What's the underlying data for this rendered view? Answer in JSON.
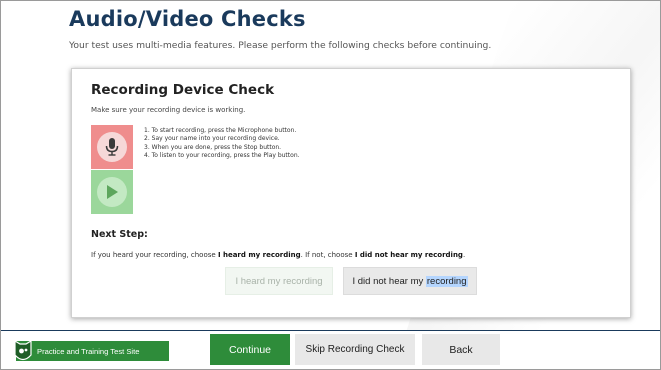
{
  "page": {
    "title": "Audio/Video Checks",
    "subtitle": "Your test uses multi-media features. Please perform the following checks before continuing."
  },
  "recording_check": {
    "title": "Recording Device Check",
    "subtitle": "Make sure your recording device is working.",
    "steps": [
      "1. To start recording, press the Microphone button.",
      "2. Say your name into your recording device.",
      "3. When you are done, press the Stop button.",
      "4. To listen to your recording, press the Play button."
    ],
    "microphone_icon": "microphone-icon",
    "play_icon": "play-icon",
    "colors": {
      "mic_bg": "#ef8d8d",
      "play_bg": "#9bd79b"
    }
  },
  "next_step": {
    "heading": "Next Step:",
    "text_1": "If you heard your recording, choose ",
    "bold_1": "I heard my recording",
    "text_2": ". If not, choose ",
    "bold_2": "I did not hear my recording",
    "text_3": ".",
    "heard_button": "I heard my recording",
    "not_heard_prefix": "I did not hear my ",
    "not_heard_highlight": "recording"
  },
  "footer": {
    "site_label": "Practice and Training Test Site",
    "continue": "Continue",
    "skip": "Skip Recording Check",
    "back": "Back",
    "accent_color": "#2e8c3a",
    "logo_icon": "owl-logo-icon"
  }
}
